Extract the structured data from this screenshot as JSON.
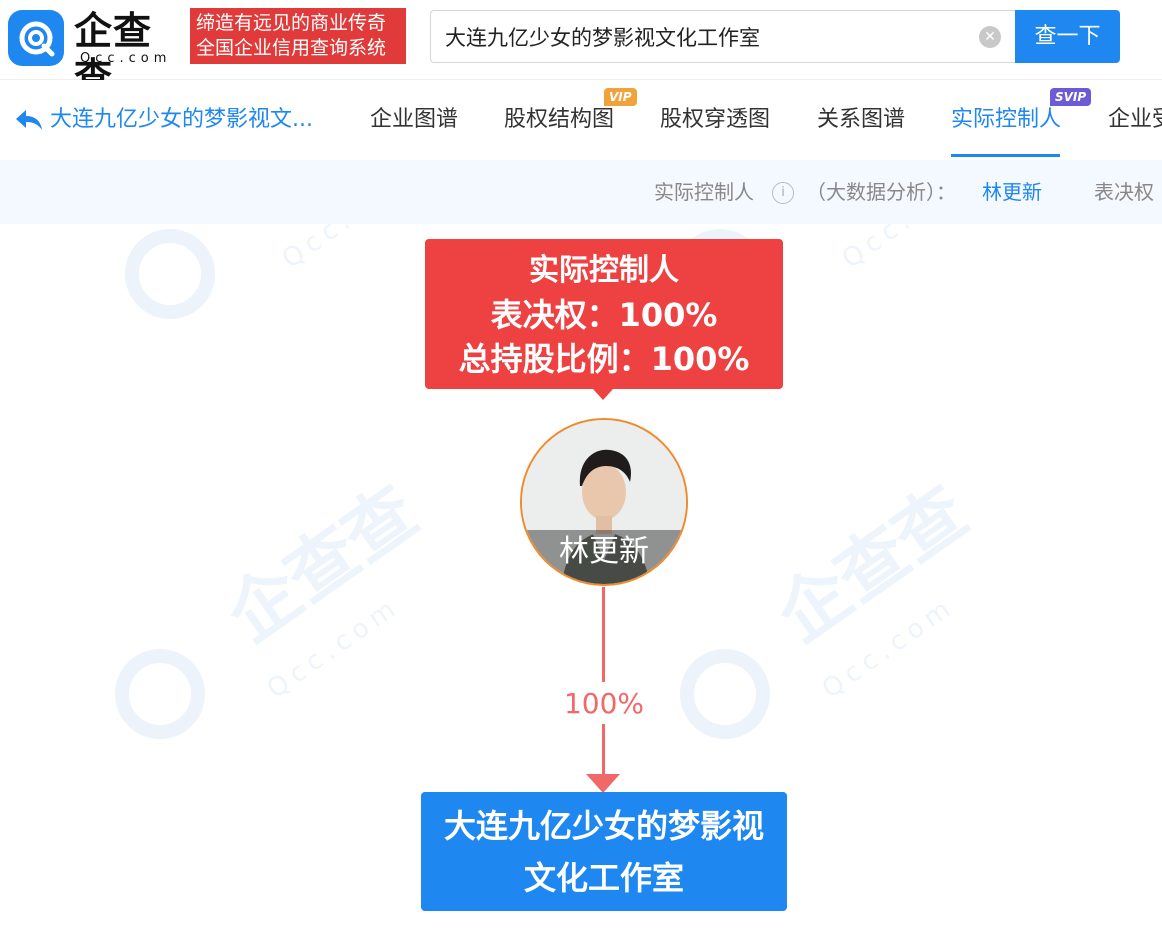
{
  "header": {
    "logo_text": "企查查",
    "logo_domain": "Qcc.com",
    "slogan_line1": "缔造有远见的商业传奇",
    "slogan_line2": "全国企业信用查询系统",
    "search_value": "大连九亿少女的梦影视文化工作室",
    "search_button": "查一下",
    "clear_icon": "clear-icon",
    "brand_color": "#1e87f0",
    "slogan_color": "#e03a3a"
  },
  "nav": {
    "back_icon": "back-arrow-icon",
    "back_label": "大连九亿少女的梦影视文...",
    "tabs": [
      {
        "label": "企业图谱"
      },
      {
        "label": "股权结构图",
        "badge": "VIP"
      },
      {
        "label": "股权穿透图"
      },
      {
        "label": "关系图谱"
      },
      {
        "label": "实际控制人",
        "badge": "SVIP",
        "active": true
      },
      {
        "label": "企业受"
      }
    ]
  },
  "info_strip": {
    "label": "实际控制人",
    "info_icon": "info-icon",
    "suffix": "（大数据分析）：",
    "value": "林更新",
    "more": "表决权"
  },
  "graph": {
    "controller_title": "实际控制人",
    "voting_rights": "表决权：100%",
    "total_shareholding": "总持股比例：100%",
    "person_name": "林更新",
    "edge_percent": "100%",
    "company_name": "大连九亿少女的梦影视文化工作室",
    "controller_color": "#ee4141",
    "company_color": "#1e87f0",
    "edge_color": "#f26868",
    "avatar_border_color": "#f08a2a"
  },
  "watermark": {
    "text": "企查查",
    "domain": "Qcc.com"
  }
}
